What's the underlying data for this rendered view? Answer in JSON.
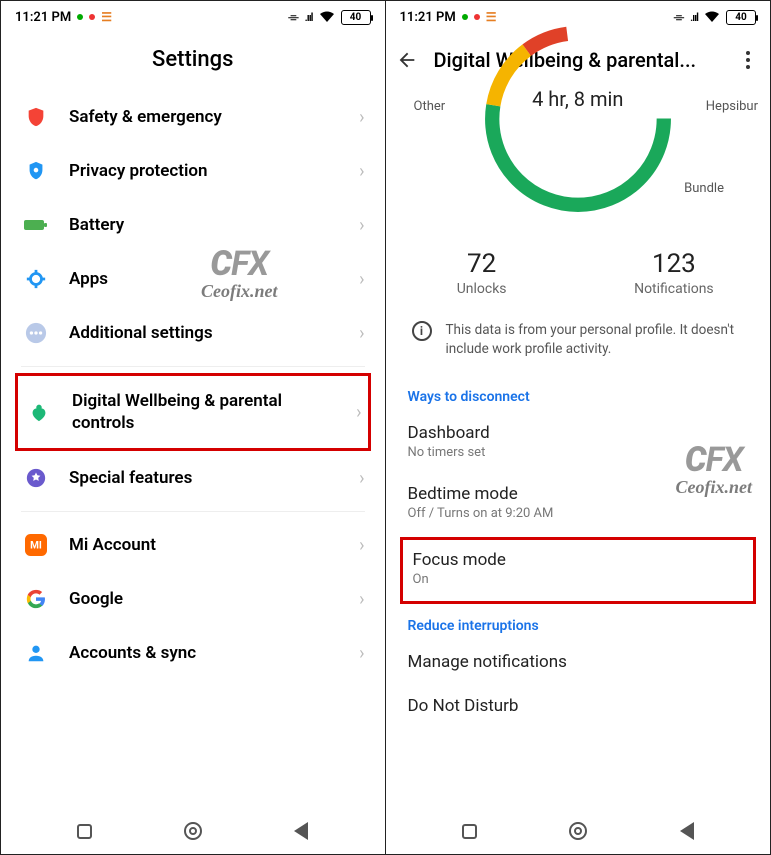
{
  "status": {
    "time": "11:21 PM",
    "battery_pct": "40",
    "bt_glyph": "✽",
    "signal_glyph": ".ııl",
    "wifi_glyph": "�྿"
  },
  "left": {
    "title": "Settings",
    "items": [
      {
        "label": "Safety & emergency",
        "icon": "shield"
      },
      {
        "label": "Privacy protection",
        "icon": "privacy"
      },
      {
        "label": "Battery",
        "icon": "battery"
      },
      {
        "label": "Apps",
        "icon": "apps"
      },
      {
        "label": "Additional settings",
        "icon": "dots"
      }
    ],
    "highlighted": {
      "label": "Digital Wellbeing & parental controls",
      "icon": "wellbeing"
    },
    "items2": [
      {
        "label": "Special features",
        "icon": "special"
      }
    ],
    "items3": [
      {
        "label": "Mi Account",
        "icon": "mi"
      },
      {
        "label": "Google",
        "icon": "google"
      },
      {
        "label": "Accounts & sync",
        "icon": "account"
      }
    ]
  },
  "right": {
    "header_title": "Digital Wellbeing & parental...",
    "chart_data": {
      "type": "pie",
      "title": "4 hr, 8 min",
      "categories": [
        "Other",
        "Hepsibur",
        "Bundle"
      ],
      "slice_labels": {
        "other": "Other",
        "hep": "Hepsibur",
        "bun": "Bundle"
      }
    },
    "stats": [
      {
        "num": "72",
        "lbl": "Unlocks"
      },
      {
        "num": "123",
        "lbl": "Notifications"
      }
    ],
    "info": "This data is from your personal profile. It doesn't include work profile activity.",
    "sect1": "Ways to disconnect",
    "opts": [
      {
        "title": "Dashboard",
        "sub": "No timers set"
      },
      {
        "title": "Bedtime mode",
        "sub": "Off / Turns on at 9:20 AM"
      }
    ],
    "focus": {
      "title": "Focus mode",
      "sub": "On"
    },
    "sect2": "Reduce interruptions",
    "opts2": [
      {
        "title": "Manage notifications",
        "sub": ""
      },
      {
        "title": "Do Not Disturb",
        "sub": ""
      }
    ]
  },
  "watermark": {
    "top": "CFX",
    "sub": "Ceofix.net"
  }
}
